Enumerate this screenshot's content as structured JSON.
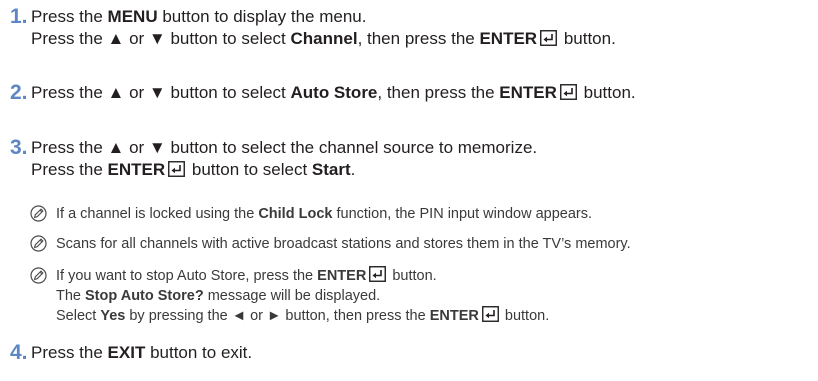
{
  "steps": [
    {
      "number": "1.",
      "lines": [
        [
          "Press the ",
          {
            "b": "MENU"
          },
          " button to display the menu."
        ],
        [
          "Press the ▲ or ▼ button to select ",
          {
            "b": "Channel"
          },
          ", then press the ",
          {
            "b": "ENTER"
          },
          {
            "icon": "enter-icon"
          },
          " button."
        ]
      ]
    },
    {
      "number": "2.",
      "lines": [
        [
          "Press the ▲ or ▼ button to select ",
          {
            "b": "Auto Store"
          },
          ", then press the ",
          {
            "b": "ENTER"
          },
          {
            "icon": "enter-icon"
          },
          " button."
        ]
      ]
    },
    {
      "number": "3.",
      "lines": [
        [
          "Press the ▲ or ▼ button to select the channel source to memorize."
        ],
        [
          "Press the ",
          {
            "b": "ENTER"
          },
          {
            "icon": "enter-icon"
          },
          " button to select ",
          {
            "b": "Start"
          },
          "."
        ]
      ]
    },
    {
      "number": "4.",
      "lines": [
        [
          "Press the ",
          {
            "b": "EXIT"
          },
          " button to exit."
        ]
      ]
    }
  ],
  "notes": [
    {
      "icon": "note-pencil-icon",
      "lines": [
        [
          "If a channel is locked using the ",
          {
            "b": "Child Lock"
          },
          " function, the PIN input window appears."
        ]
      ]
    },
    {
      "icon": "note-pencil-icon",
      "lines": [
        [
          "Scans for all channels with active broadcast stations and stores them in the TV’s memory."
        ]
      ]
    },
    {
      "icon": "note-pencil-icon",
      "lines": [
        [
          "If you want to stop Auto Store, press the ",
          {
            "b": "ENTER"
          },
          {
            "icon": "enter-icon"
          },
          " button."
        ],
        [
          "The ",
          {
            "b": "Stop Auto Store?"
          },
          " message will be displayed."
        ],
        [
          "Select ",
          {
            "b": "Yes"
          },
          " by pressing the ◄ or ► button, then press the ",
          {
            "b": "ENTER"
          },
          {
            "icon": "enter-icon"
          },
          " button."
        ]
      ]
    }
  ],
  "colors": {
    "step_number": "#5c86c4",
    "body_text": "#231f20",
    "note_text": "#3a3a3a"
  }
}
